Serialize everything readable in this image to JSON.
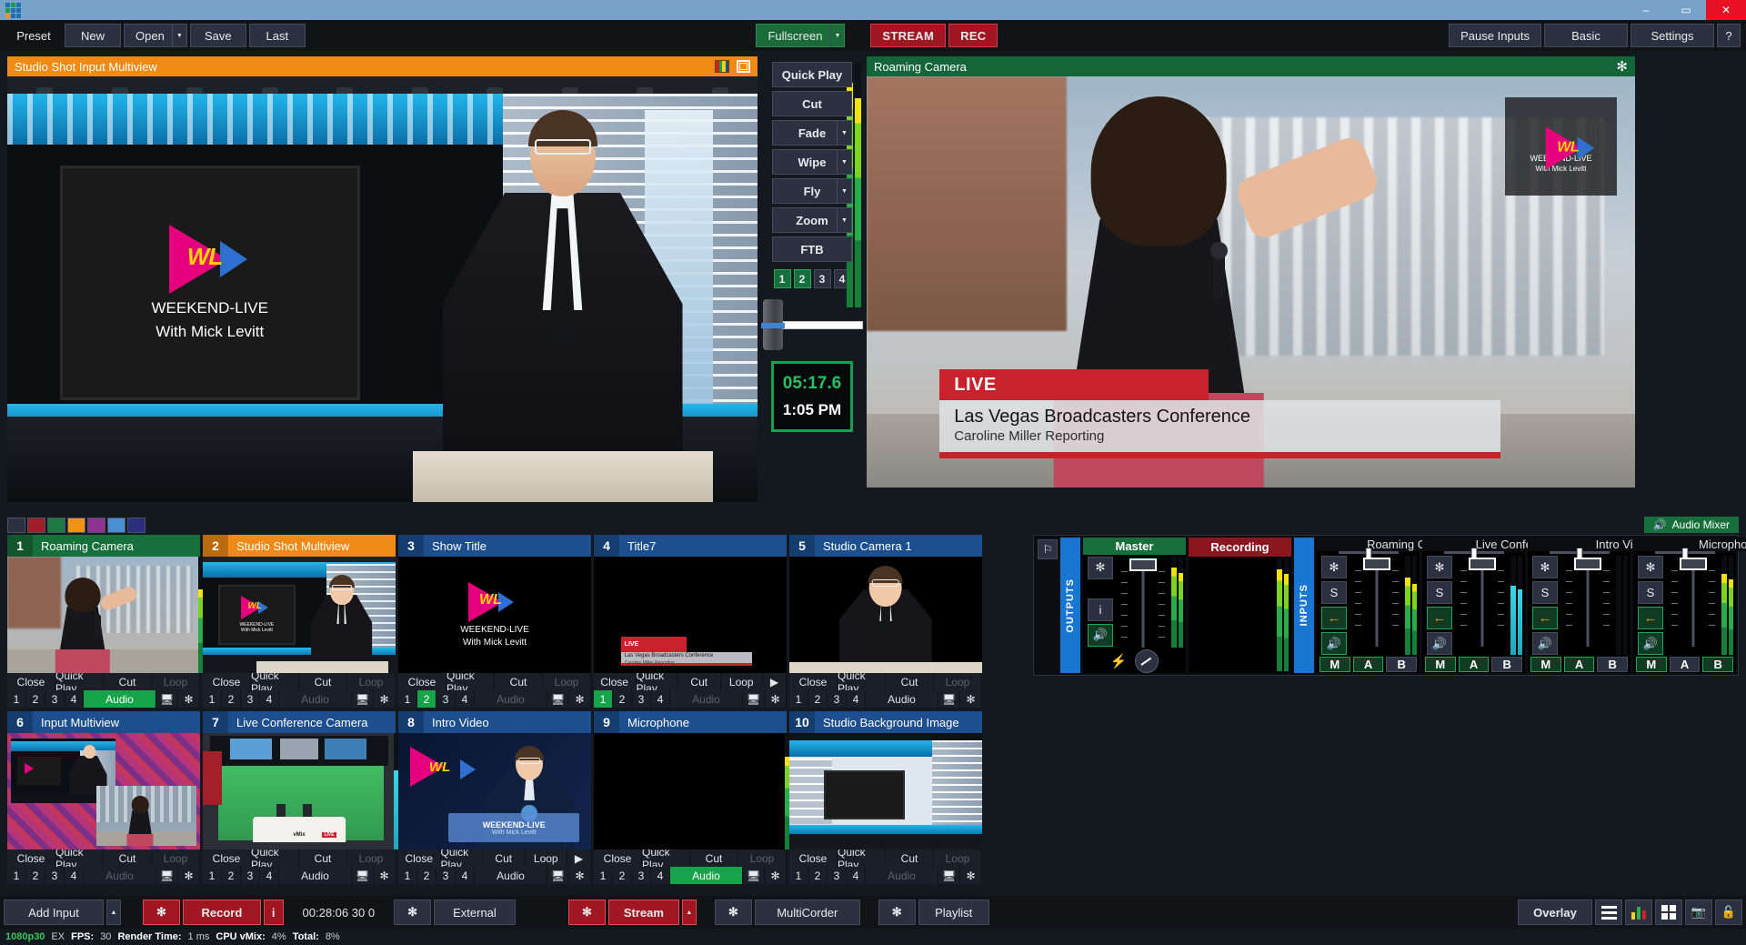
{
  "window": {
    "logo_name": "vmix-logo",
    "minimize": "–",
    "maximize": "▭",
    "close": "✕"
  },
  "menubar": {
    "preset_label": "Preset",
    "new_label": "New",
    "open_label": "Open",
    "save_label": "Save",
    "last_label": "Last",
    "fullscreen_label": "Fullscreen",
    "stream_label": "STREAM",
    "rec_label": "REC",
    "pause_inputs_label": "Pause Inputs",
    "basic_label": "Basic",
    "settings_label": "Settings",
    "help_label": "?"
  },
  "preview": {
    "title": "Studio Shot Input Multiview",
    "screen_line1": "WEEKEND-LIVE",
    "screen_line2": "With Mick Levitt",
    "wl_text": "WL"
  },
  "program": {
    "title": "Roaming Camera",
    "pip_line1": "WEEKEND-LIVE",
    "pip_line2": "With Mick Levitt",
    "pip_wl": "WL",
    "lower_third": {
      "tag": "LIVE",
      "title": "Las Vegas Broadcasters Conference",
      "subtitle": "Caroline Miller Reporting"
    }
  },
  "transitions": {
    "buttons": [
      {
        "label": "Quick Play",
        "has_caret": false
      },
      {
        "label": "Cut",
        "has_caret": false
      },
      {
        "label": "Fade",
        "has_caret": true
      },
      {
        "label": "Wipe",
        "has_caret": true
      },
      {
        "label": "Fly",
        "has_caret": true
      },
      {
        "label": "Zoom",
        "has_caret": true
      },
      {
        "label": "FTB",
        "has_caret": false
      }
    ],
    "numbers": [
      {
        "label": "1",
        "active": true
      },
      {
        "label": "2",
        "active": true
      },
      {
        "label": "3",
        "active": false
      },
      {
        "label": "4",
        "active": false
      }
    ],
    "tbar_position_pct": 4
  },
  "clock": {
    "timer": "05:17.6",
    "time_of_day": "1:05 PM"
  },
  "swatches": {
    "colors": [
      "#2b3140",
      "#9e2026",
      "#1c7a42",
      "#f09213",
      "#8e3391",
      "#4a8ed4",
      "#2c2f80"
    ],
    "audio_mixer_label": "Audio Mixer"
  },
  "inputs": [
    {
      "num": "1",
      "name": "Roaming Camera",
      "state": "live",
      "actions": [
        "Close",
        "Quick Play",
        "Cut",
        "Loop"
      ],
      "loop_enabled": false,
      "has_play": false,
      "nums": [
        false,
        false,
        false,
        false
      ],
      "audio": "on",
      "thumb": "reporter"
    },
    {
      "num": "2",
      "name": "Studio Shot Multiview",
      "state": "preview",
      "actions": [
        "Close",
        "Quick Play",
        "Cut",
        "Loop"
      ],
      "loop_enabled": false,
      "has_play": false,
      "nums": [
        false,
        false,
        false,
        false
      ],
      "audio": "off",
      "thumb": "studio"
    },
    {
      "num": "3",
      "name": "Show Title",
      "state": "idle",
      "actions": [
        "Close",
        "Quick Play",
        "Cut",
        "Loop"
      ],
      "loop_enabled": false,
      "has_play": false,
      "nums": [
        false,
        true,
        false,
        false
      ],
      "audio": "off",
      "thumb": "title"
    },
    {
      "num": "4",
      "name": "Title7",
      "state": "idle",
      "actions": [
        "Close",
        "Quick Play",
        "Cut",
        "Loop"
      ],
      "loop_enabled": true,
      "has_play": true,
      "nums": [
        true,
        false,
        false,
        false
      ],
      "audio": "off",
      "thumb": "lower3"
    },
    {
      "num": "5",
      "name": "Studio Camera 1",
      "state": "idle",
      "actions": [
        "Close",
        "Quick Play",
        "Cut",
        "Loop"
      ],
      "loop_enabled": false,
      "has_play": false,
      "nums": [
        false,
        false,
        false,
        false
      ],
      "audio": "on",
      "thumb": "anchor"
    },
    {
      "num": "6",
      "name": "Input Multiview",
      "state": "idle",
      "actions": [
        "Close",
        "Quick Play",
        "Cut",
        "Loop"
      ],
      "loop_enabled": false,
      "has_play": false,
      "nums": [
        false,
        false,
        false,
        false
      ],
      "audio": "off",
      "thumb": "multiview"
    },
    {
      "num": "7",
      "name": "Live Conference Camera",
      "state": "idle",
      "actions": [
        "Close",
        "Quick Play",
        "Cut",
        "Loop"
      ],
      "loop_enabled": false,
      "has_play": false,
      "nums": [
        false,
        false,
        false,
        false
      ],
      "audio": "on",
      "thumb": "greenscreen"
    },
    {
      "num": "8",
      "name": "Intro Video",
      "state": "idle",
      "actions": [
        "Close",
        "Quick Play",
        "Cut",
        "Loop"
      ],
      "loop_enabled": true,
      "has_play": true,
      "nums": [
        false,
        false,
        false,
        false
      ],
      "audio": "on",
      "thumb": "intro"
    },
    {
      "num": "9",
      "name": "Microphone",
      "state": "idle",
      "actions": [
        "Close",
        "Quick Play",
        "Cut",
        "Loop"
      ],
      "loop_enabled": false,
      "has_play": false,
      "nums": [
        false,
        false,
        false,
        false
      ],
      "audio": "on",
      "thumb": "black"
    },
    {
      "num": "10",
      "name": "Studio Background Image",
      "state": "idle",
      "actions": [
        "Close",
        "Quick Play",
        "Cut",
        "Loop"
      ],
      "loop_enabled": false,
      "has_play": false,
      "nums": [
        false,
        false,
        false,
        false
      ],
      "audio": "off",
      "thumb": "bgimage"
    }
  ],
  "input_controls": {
    "monitor_icon": "monitor-icon",
    "gear_icon": "gear-icon",
    "play_icon": "▶"
  },
  "mixer": {
    "pin_icon": "⚐",
    "outputs_label": "OUTPUTS",
    "inputs_label": "INPUTS",
    "outputs": [
      {
        "name": "Master",
        "type": "master",
        "solo": false,
        "bus_arrow": false,
        "mute_on": true,
        "meter_pct": 88,
        "fader_pct": 56,
        "has_headphones": true,
        "mab": null
      },
      {
        "name": "Recording",
        "type": "recording",
        "solo": false,
        "bus_arrow": false,
        "mute_on": false,
        "meter_pct": 90,
        "fader_pct": 0,
        "has_headphones": false,
        "mab": null
      }
    ],
    "inputs_strips": [
      {
        "name": "Roaming Camera",
        "solo_label": "S",
        "mute_on": true,
        "meter_pct": 78,
        "meter_color": "green",
        "fader_pct": 56,
        "mab": [
          {
            "label": "M",
            "on": true
          },
          {
            "label": "A",
            "on": true
          },
          {
            "label": "B",
            "on": false
          }
        ]
      },
      {
        "name": "Live Conference",
        "solo_label": "S",
        "mute_on": false,
        "meter_pct": 70,
        "meter_color": "cyan",
        "fader_pct": 56,
        "mab": [
          {
            "label": "M",
            "on": true
          },
          {
            "label": "A",
            "on": true
          },
          {
            "label": "B",
            "on": false
          }
        ]
      },
      {
        "name": "Intro Video",
        "solo_label": "S",
        "mute_on": false,
        "meter_pct": 0,
        "meter_color": "green",
        "fader_pct": 56,
        "mab": [
          {
            "label": "M",
            "on": true
          },
          {
            "label": "A",
            "on": true
          },
          {
            "label": "B",
            "on": false
          }
        ]
      },
      {
        "name": "Microphone",
        "solo_label": "S",
        "mute_on": true,
        "meter_pct": 82,
        "meter_color": "green",
        "fader_pct": 56,
        "mab": [
          {
            "label": "M",
            "on": true
          },
          {
            "label": "A",
            "on": false
          },
          {
            "label": "B",
            "on": true
          }
        ]
      }
    ],
    "info_label": "i",
    "gear_icon": "✻",
    "speaker_icon": "ღ",
    "arrow_icon": "←",
    "headphone_icon": "∩"
  },
  "bottombar": {
    "add_input_label": "Add Input",
    "add_input_caret": "▲",
    "record_label": "Record",
    "record_info": "i",
    "timecode": "00:28:06 30 0",
    "external_label": "External",
    "stream_label": "Stream",
    "stream_caret": "▲",
    "multicorder_label": "MultiCorder",
    "playlist_label": "Playlist",
    "overlay_label": "Overlay",
    "list_icon": "list-icon",
    "audio_icon": "audio-bars-icon",
    "grid_icon": "grid-icon",
    "snapshot_icon": "snapshot-icon",
    "lock_icon": "lock-icon"
  },
  "status": {
    "resolution": "1080p30",
    "ex": "EX",
    "fps_label": "FPS:",
    "fps_value": "30",
    "render_label": "Render Time:",
    "render_value": "1 ms",
    "cpu_label": "CPU vMix:",
    "cpu_value": "4%",
    "total_label": "Total:",
    "total_value": "8%"
  }
}
